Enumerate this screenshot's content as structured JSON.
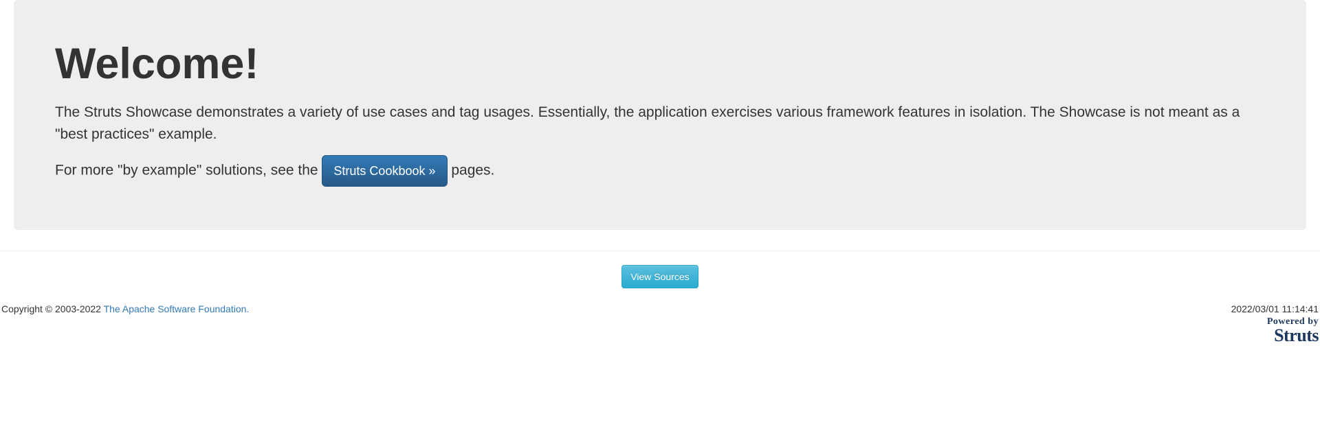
{
  "jumbotron": {
    "title": "Welcome!",
    "description": "The Struts Showcase demonstrates a variety of use cases and tag usages. Essentially, the application exercises various framework features in isolation. The Showcase is not meant as a \"best practices\" example.",
    "more_text_before": "For more \"by example\" solutions, see the ",
    "cookbook_label": "Struts Cookbook »",
    "more_text_after": " pages."
  },
  "actions": {
    "view_sources_label": "View Sources"
  },
  "footer": {
    "copyright_prefix": "Copyright © 2003-2022 ",
    "foundation_link": "The Apache Software Foundation.",
    "timestamp": "2022/03/01 11:14:41",
    "logo_top": "Powered by",
    "logo_bottom": "Struts"
  }
}
